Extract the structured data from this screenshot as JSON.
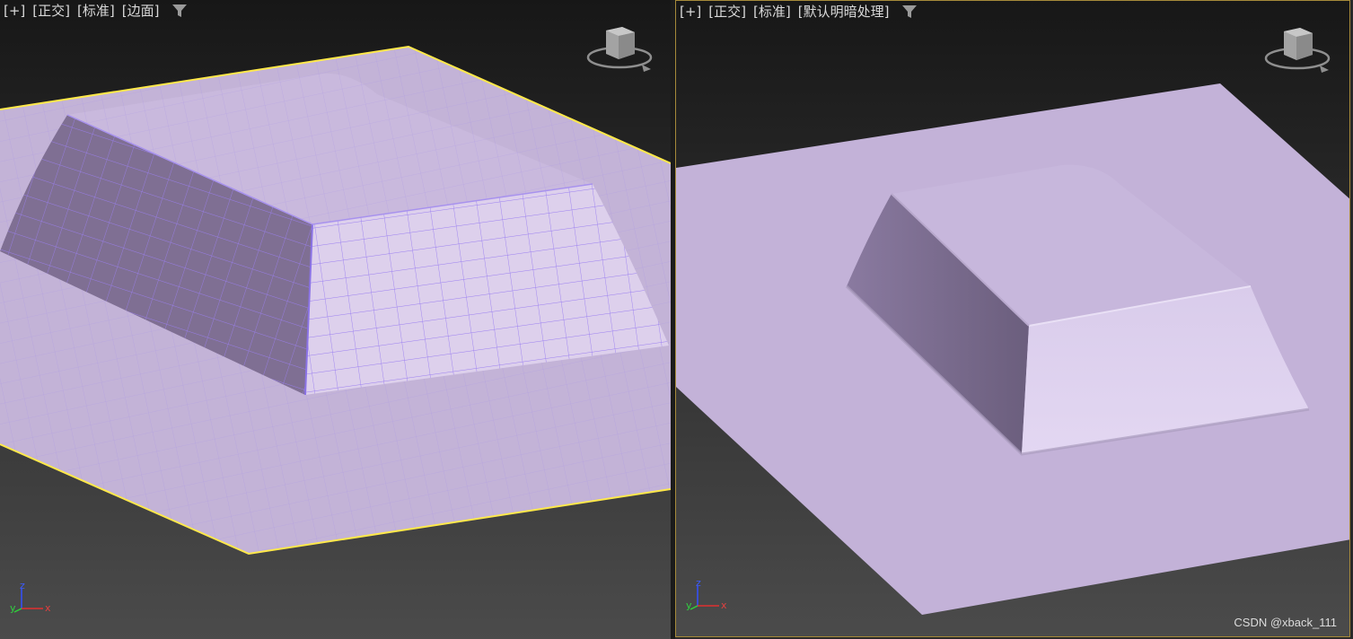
{
  "left_viewport": {
    "labels": [
      "[+]",
      "[正交]",
      "[标准]",
      "[边面]"
    ]
  },
  "right_viewport": {
    "labels": [
      "[+]",
      "[正交]",
      "[标准]",
      "[默认明暗处理]"
    ]
  },
  "axis": {
    "x": "x",
    "y": "y",
    "z": "z"
  },
  "watermark": "CSDN @xback_111",
  "colors": {
    "background_top": "#1a1a1a",
    "background_bottom": "#4a4a4a",
    "surface": "#c4b3d8",
    "wire": "#9c83e8",
    "selection": "#ffe94a",
    "active_border": "#a68a3a"
  },
  "icons": [
    "filter-icon",
    "viewcube-icon",
    "axis-tripod-icon"
  ]
}
